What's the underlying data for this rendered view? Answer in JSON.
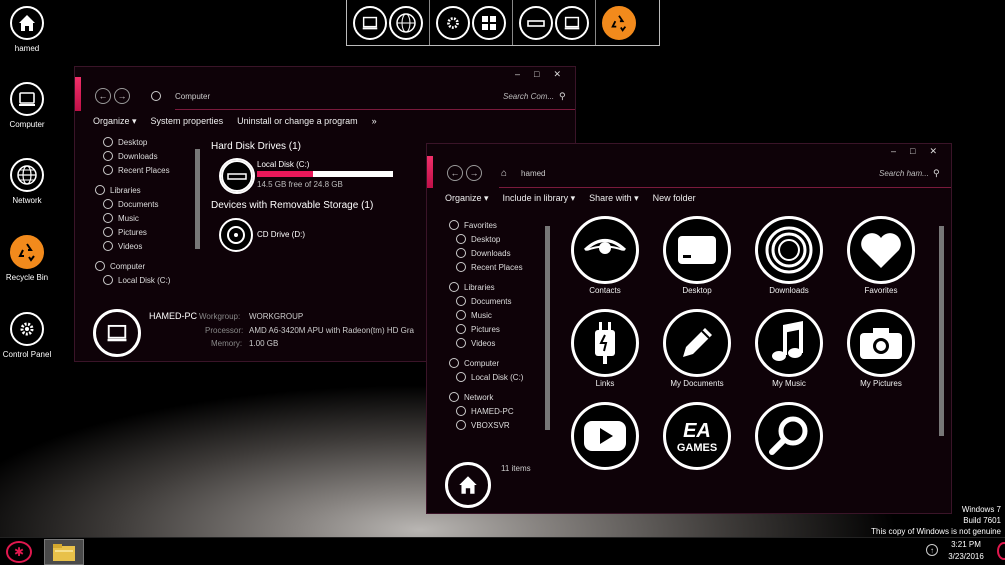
{
  "desktop": {
    "icons": [
      {
        "label": "hamed",
        "icon": "home-icon"
      },
      {
        "label": "Computer",
        "icon": "computer-icon"
      },
      {
        "label": "Network",
        "icon": "globe-icon"
      },
      {
        "label": "Recycle Bin",
        "icon": "recycle-icon"
      },
      {
        "label": "Control Panel",
        "icon": "gear-icon"
      }
    ],
    "watermark": {
      "line1": "Windows 7",
      "line2": "Build 7601",
      "line3": "This copy of Windows is not genuine"
    },
    "accent_color": "#f0306a"
  },
  "dock": {
    "groups": [
      [
        "computer-icon",
        "globe-icon"
      ],
      [
        "gear-icon",
        "windows-icon"
      ],
      [
        "drive-icon",
        "computer-icon"
      ],
      [
        "recycle-icon"
      ]
    ]
  },
  "window_computer": {
    "address": "Computer",
    "search_placeholder": "Search Com...",
    "controls": {
      "minimize": "–",
      "maximize": "□",
      "close": "✕"
    },
    "toolbar": {
      "organize": "Organize ▾",
      "system_properties": "System properties",
      "uninstall": "Uninstall or change a program",
      "more": "»"
    },
    "nav": {
      "desktop": "Desktop",
      "downloads": "Downloads",
      "recent": "Recent Places",
      "libraries": "Libraries",
      "documents": "Documents",
      "music": "Music",
      "pictures": "Pictures",
      "videos": "Videos",
      "computer": "Computer",
      "local_disk": "Local Disk (C:)"
    },
    "hard_disk_header": "Hard Disk Drives (1)",
    "local_disk_name": "Local Disk (C:)",
    "local_disk_free": "14.5 GB free of 24.8 GB",
    "local_disk_used_fraction": 0.415,
    "removable_header": "Devices with Removable Storage (1)",
    "cd_drive": "CD Drive (D:)",
    "details": {
      "pc_name": "HAMED-PC",
      "workgroup_label": "Workgroup:",
      "workgroup": "WORKGROUP",
      "processor_label": "Processor:",
      "processor": "AMD A6-3420M APU with Radeon(tm) HD Gra",
      "memory_label": "Memory:",
      "memory": "1.00 GB"
    }
  },
  "window_hamed": {
    "address": "hamed",
    "search_placeholder": "Search ham...",
    "controls": {
      "minimize": "–",
      "maximize": "□",
      "close": "✕"
    },
    "toolbar": {
      "organize": "Organize ▾",
      "include": "Include in library ▾",
      "share": "Share with ▾",
      "new_folder": "New folder"
    },
    "nav": {
      "favorites": "Favorites",
      "desktop": "Desktop",
      "downloads": "Downloads",
      "recent": "Recent Places",
      "libraries": "Libraries",
      "documents": "Documents",
      "music": "Music",
      "pictures": "Pictures",
      "videos": "Videos",
      "computer": "Computer",
      "local_disk": "Local Disk (C:)",
      "network": "Network",
      "hamed_pc": "HAMED-PC",
      "vboxsvr": "VBOXSVR"
    },
    "items": [
      {
        "label": "Contacts",
        "icon": "eye-icon"
      },
      {
        "label": "Desktop",
        "icon": "desktop-icon"
      },
      {
        "label": "Downloads",
        "icon": "downloads-icon"
      },
      {
        "label": "Favorites",
        "icon": "heart-icon"
      },
      {
        "label": "Links",
        "icon": "plug-icon"
      },
      {
        "label": "My Documents",
        "icon": "pencil-icon"
      },
      {
        "label": "My Music",
        "icon": "music-icon"
      },
      {
        "label": "My Pictures",
        "icon": "camera-icon"
      },
      {
        "label": "",
        "icon": "youtube-icon"
      },
      {
        "label": "",
        "icon": "ea-games-icon",
        "logo_text": "EA GAMES"
      },
      {
        "label": "",
        "icon": "search-icon"
      }
    ],
    "item_count": "11 items"
  },
  "taskbar": {
    "time": "3:21 PM",
    "date": "3/23/2016"
  }
}
